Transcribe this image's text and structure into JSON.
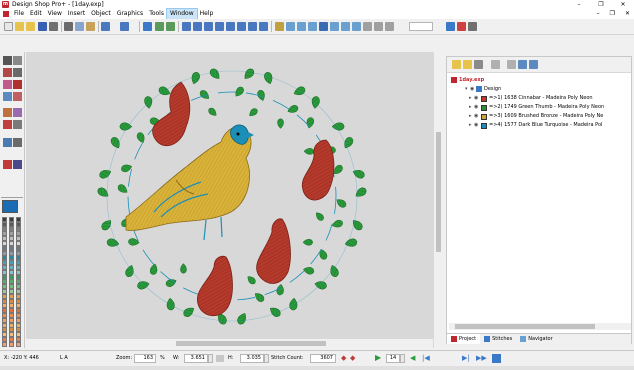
{
  "window": {
    "title": "Design Shop Pro+ - [1day.exp]",
    "controls": [
      "–",
      "❐",
      "✕"
    ]
  },
  "menu": {
    "items": [
      "File",
      "Edit",
      "View",
      "Insert",
      "Object",
      "Graphics",
      "Tools",
      "Window",
      "Help"
    ],
    "active": "Window",
    "mdi_controls": [
      "–",
      "❐",
      "✕"
    ]
  },
  "panel": {
    "file_name": "1day.exp",
    "design_label": "Design",
    "threads": [
      {
        "index": "1",
        "text": "=>1) 1638 Cinnabar - Madeira Poly Neon",
        "color": "#c0392b"
      },
      {
        "index": "2",
        "text": "=>2) 1749 Green Thumb - Madeira Poly Neon",
        "color": "#2e8b3a"
      },
      {
        "index": "3",
        "text": "=>3) 1609 Brushed Bronze - Madeira Poly Ne",
        "color": "#c8a63a"
      },
      {
        "index": "4",
        "text": "=>4) 1577 Dark Blue Turquoise - Madeira Pol",
        "color": "#1b8fb8"
      }
    ],
    "tabs": [
      "Project",
      "Stitches",
      "Navigator"
    ]
  },
  "status": {
    "coords": "X: -220  Y: 446",
    "mode": "L A",
    "zoom_label": "Zoom:",
    "zoom_value": "163",
    "zoom_unit": "%",
    "w_label": "W:",
    "w_value": "3.651",
    "h_label": "H:",
    "h_value": "3.035",
    "stitch_label": "Stitch Count:",
    "stitch_value": "3607",
    "frame_value": "14"
  },
  "colors": {
    "accent": "#c0262d",
    "canvas": "#d8d8d8",
    "leaf": "#2a9a3a",
    "pear": "#b53a2c",
    "bird": "#d9b23a",
    "outline": "#1b8fb8"
  }
}
